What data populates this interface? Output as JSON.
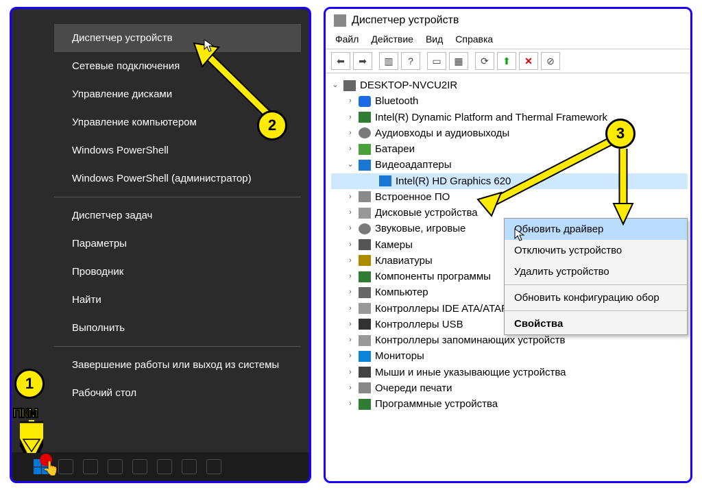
{
  "winx": {
    "items": [
      {
        "label": "Диспетчер устройств",
        "selected": true
      },
      {
        "label": "Сетевые подключения"
      },
      {
        "label": "Управление дисками"
      },
      {
        "label": "Управление компьютером"
      },
      {
        "label": "Windows PowerShell"
      },
      {
        "label": "Windows PowerShell (администратор)"
      },
      {
        "sep": true
      },
      {
        "label": "Диспетчер задач"
      },
      {
        "label": "Параметры"
      },
      {
        "label": "Проводник"
      },
      {
        "label": "Найти"
      },
      {
        "label": "Выполнить"
      },
      {
        "sep": true
      },
      {
        "label": "Завершение работы или выход из системы"
      },
      {
        "label": "Рабочий стол"
      }
    ]
  },
  "annotations": {
    "pkm": "ПКМ",
    "badges": {
      "one": "1",
      "two": "2",
      "three": "3"
    }
  },
  "dm": {
    "title": "Диспетчер устройств",
    "menu": [
      "Файл",
      "Действие",
      "Вид",
      "Справка"
    ],
    "root": "DESKTOP-NVCU2IR",
    "nodes": [
      {
        "label": "Bluetooth",
        "ic": "bt"
      },
      {
        "label": "Intel(R) Dynamic Platform and Thermal Framework",
        "ic": "chip"
      },
      {
        "label": "Аудиовходы и аудиовыходы",
        "ic": "snd"
      },
      {
        "label": "Батареи",
        "ic": "bat"
      },
      {
        "label": "Видеоадаптеры",
        "ic": "disp",
        "expanded": true,
        "children": [
          {
            "label": "Intel(R) HD Graphics 620",
            "ic": "disp",
            "selected": true
          }
        ]
      },
      {
        "label": "Встроенное ПО",
        "ic": "fw"
      },
      {
        "label": "Дисковые устройства",
        "ic": "hdd",
        "cut": true
      },
      {
        "label": "Звуковые, игровые",
        "ic": "snd",
        "cut": true
      },
      {
        "label": "Камеры",
        "ic": "cam"
      },
      {
        "label": "Клавиатуры",
        "ic": "kb"
      },
      {
        "label": "Компоненты программы",
        "ic": "chip",
        "cut": true
      },
      {
        "label": "Компьютер",
        "ic": "pc"
      },
      {
        "label": "Контроллеры IDE ATA/ATAPI",
        "ic": "hdd"
      },
      {
        "label": "Контроллеры USB",
        "ic": "usb"
      },
      {
        "label": "Контроллеры запоминающих устройств",
        "ic": "hdd"
      },
      {
        "label": "Мониторы",
        "ic": "mon"
      },
      {
        "label": "Мыши и иные указывающие устройства",
        "ic": "ms"
      },
      {
        "label": "Очереди печати",
        "ic": "pr"
      },
      {
        "label": "Программные устройства",
        "ic": "chip"
      }
    ],
    "ctx": {
      "items": [
        {
          "label": "Обновить драйвер",
          "hl": true
        },
        {
          "label": "Отключить устройство"
        },
        {
          "label": "Удалить устройство"
        },
        {
          "sep": true
        },
        {
          "label": "Обновить конфигурацию оборудования",
          "cut": true
        },
        {
          "sep": true
        },
        {
          "label": "Свойства",
          "bold": true
        }
      ]
    }
  }
}
